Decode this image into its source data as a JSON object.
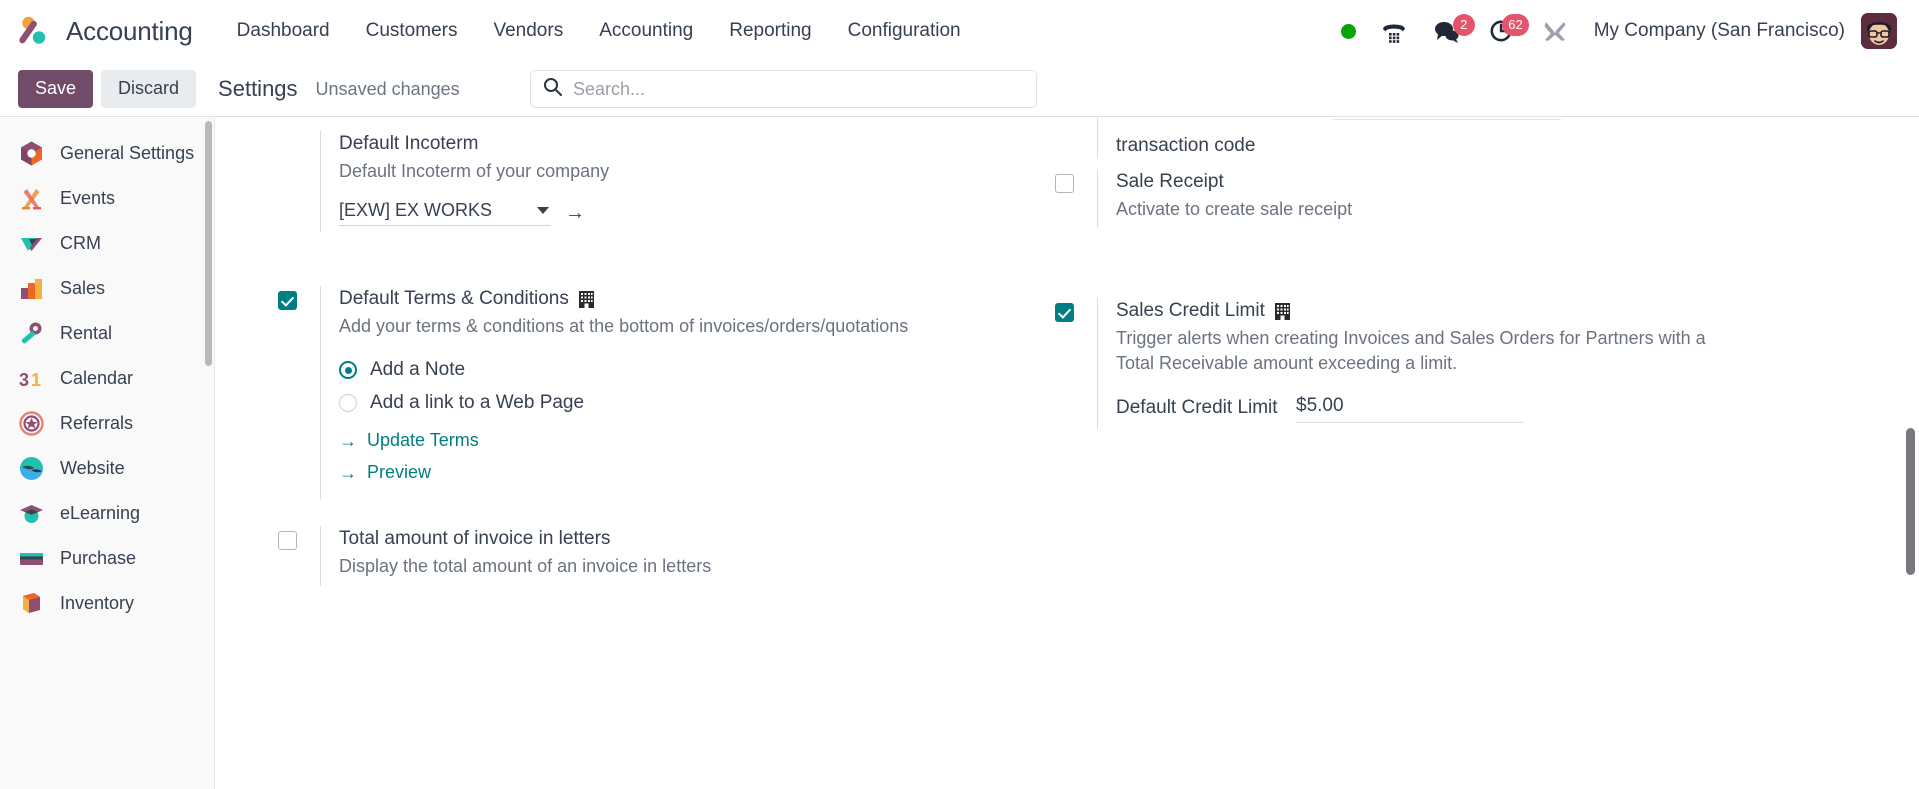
{
  "navbar": {
    "brand": "Accounting",
    "logo_icon": "odoo-logo",
    "menu": [
      "Dashboard",
      "Customers",
      "Vendors",
      "Accounting",
      "Reporting",
      "Configuration"
    ],
    "status_dot_color": "#05A502",
    "icons": [
      {
        "name": "presence-dot",
        "label": ""
      },
      {
        "name": "phone-dialpad-icon",
        "label": ""
      },
      {
        "name": "messages-icon",
        "badge": "2"
      },
      {
        "name": "activities-clock-icon",
        "badge": "62"
      },
      {
        "name": "developer-tools-icon",
        "label": ""
      }
    ],
    "messages_badge": "2",
    "activities_badge": "62",
    "company": "My Company (San Francisco)",
    "avatar_name": "user-avatar"
  },
  "control_panel": {
    "save_label": "Save",
    "discard_label": "Discard",
    "title": "Settings",
    "status": "Unsaved changes",
    "search_placeholder": "Search..."
  },
  "sidebar": {
    "items": [
      {
        "label": "General Settings",
        "icon": "general-settings-icon"
      },
      {
        "label": "Events",
        "icon": "events-icon"
      },
      {
        "label": "CRM",
        "icon": "crm-icon"
      },
      {
        "label": "Sales",
        "icon": "sales-icon"
      },
      {
        "label": "Rental",
        "icon": "rental-icon"
      },
      {
        "label": "Calendar",
        "icon": "calendar-icon"
      },
      {
        "label": "Referrals",
        "icon": "referrals-icon"
      },
      {
        "label": "Website",
        "icon": "website-icon"
      },
      {
        "label": "eLearning",
        "icon": "elearning-icon"
      },
      {
        "label": "Purchase",
        "icon": "purchase-icon"
      },
      {
        "label": "Inventory",
        "icon": "inventory-icon"
      }
    ]
  },
  "settings": {
    "left": {
      "incoterm": {
        "label": "Default Incoterm",
        "help": "Default Incoterm of your company",
        "value": "[EXW] EX WORKS",
        "internal_link": "→"
      },
      "terms": {
        "label": "Default Terms & Conditions",
        "help": "Add your terms & conditions at the bottom of invoices/orders/quotations",
        "checked": true,
        "company_dependent": true,
        "options": [
          {
            "label": "Add a Note",
            "selected": true
          },
          {
            "label": "Add a link to a Web Page",
            "selected": false
          }
        ],
        "links": [
          {
            "label": "Update Terms",
            "arrow": "→"
          },
          {
            "label": "Preview",
            "arrow": "→"
          }
        ]
      },
      "total_letters": {
        "label": "Total amount of invoice in letters",
        "help": "Display the total amount of an invoice in letters",
        "checked": false
      }
    },
    "right": {
      "fragment_text": "transaction code",
      "sale_receipt": {
        "label": "Sale Receipt",
        "help": "Activate to create sale receipt",
        "checked": false
      },
      "credit_limit": {
        "label": "Sales Credit Limit",
        "help": "Trigger alerts when creating Invoices and Sales Orders for Partners with a Total Receivable amount exceeding a limit.",
        "checked": true,
        "company_dependent": true,
        "field_label": "Default Credit Limit",
        "field_value": "$5.00"
      }
    }
  },
  "colors": {
    "brand_purple": "#714B67",
    "accent_teal": "#017E84",
    "badge_red": "#E4546A",
    "online_green": "#05A502"
  }
}
